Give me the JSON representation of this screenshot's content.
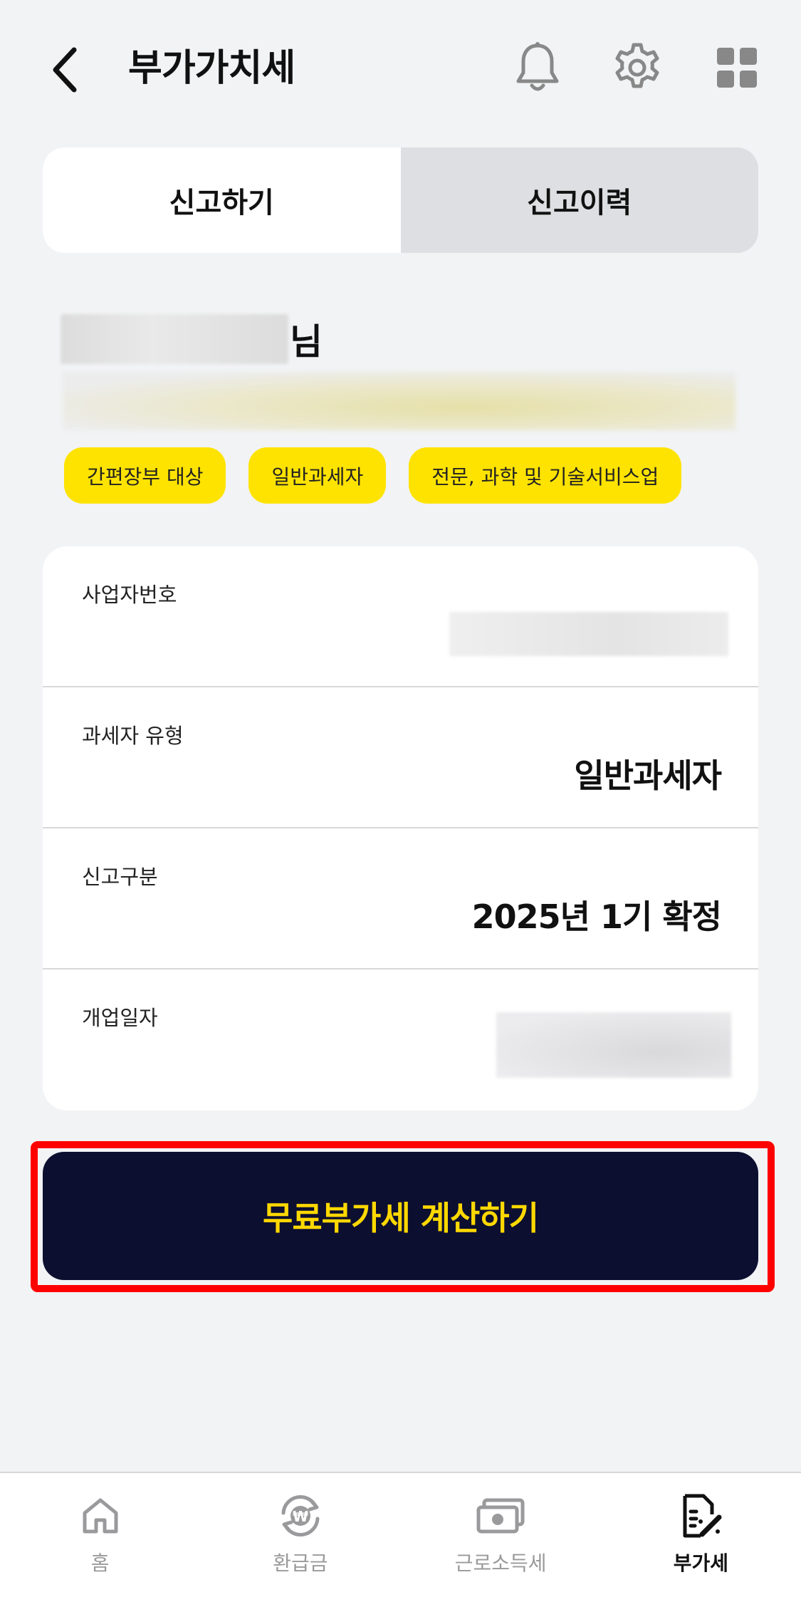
{
  "header": {
    "title": "부가가치세",
    "icons": [
      "chevron-left-icon",
      "bell-icon",
      "gear-icon",
      "grid-icon"
    ]
  },
  "tabs": [
    {
      "label": "신고하기",
      "active": true
    },
    {
      "label": "신고이력",
      "active": false
    }
  ],
  "user": {
    "name_suffix": "님"
  },
  "chips": [
    "간편장부 대상",
    "일반과세자",
    "전문, 과학 및 기술서비스업"
  ],
  "info": {
    "business_number_label": "사업자번호",
    "taxpayer_type_label": "과세자 유형",
    "taxpayer_type_value": "일반과세자",
    "filing_type_label": "신고구분",
    "filing_type_value": "2025년 1기 확정",
    "opening_date_label": "개업일자"
  },
  "cta": {
    "label": "무료부가세 계산하기"
  },
  "bottom_nav": [
    {
      "label": "홈",
      "icon": "home-icon",
      "active": false
    },
    {
      "label": "환급금",
      "icon": "refund-won-icon",
      "active": false
    },
    {
      "label": "근로소득세",
      "icon": "cash-icon",
      "active": false
    },
    {
      "label": "부가세",
      "icon": "document-edit-icon",
      "active": true
    }
  ],
  "colors": {
    "accent_yellow": "#ffe300",
    "button_dark": "#0c0f2f",
    "button_text": "#ffd800",
    "highlight_red": "#ff0000",
    "background": "#f2f3f5"
  }
}
